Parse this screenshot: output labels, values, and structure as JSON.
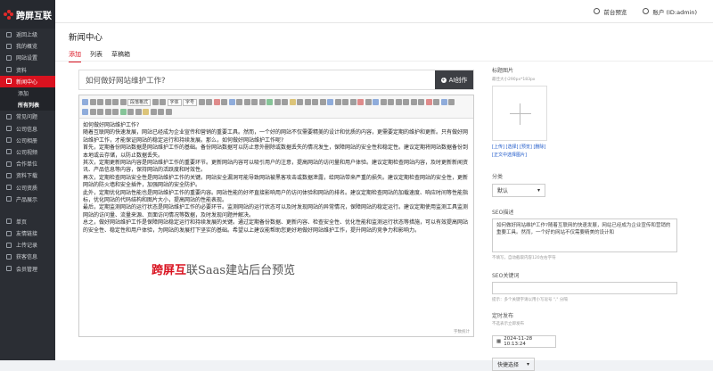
{
  "brand": {
    "name": "跨屏互联"
  },
  "sidebar": {
    "items": [
      {
        "label": "返回上级"
      },
      {
        "label": "我的概览"
      },
      {
        "label": "网站设置"
      },
      {
        "label": "资料"
      },
      {
        "label": "新闻中心",
        "active": true
      },
      {
        "label": "添加",
        "sub": true
      },
      {
        "label": "所有列表",
        "sub": true,
        "on": true
      },
      {
        "label": "常见问题"
      },
      {
        "label": "公司信息"
      },
      {
        "label": "公司相册"
      },
      {
        "label": "公司视频"
      },
      {
        "label": "合作单位"
      },
      {
        "label": "资料下载"
      },
      {
        "label": "公司资质"
      },
      {
        "label": "产品展示"
      },
      {
        "label": "单页"
      },
      {
        "label": "友情链接"
      },
      {
        "label": "上传记录"
      },
      {
        "label": "获客信息"
      },
      {
        "label": "会员管理"
      }
    ]
  },
  "topbar": {
    "preview": "前台预览",
    "account": "账户 (ID:admin)"
  },
  "page": {
    "title": "新闻中心"
  },
  "tabs": [
    "添加",
    "列表",
    "草稿箱"
  ],
  "article": {
    "title_value": "如何做好网站维护工作?",
    "ai_button": "AI创作",
    "paragraphs": [
      "如何做好网站维护工作?",
      "随着互联网的快速发展，网站已经成为企业宣传和营销的重要工具。然而，一个好的网站不仅需要精美的设计和优质的内容，更需要定期的维护和更新。只有做好网站维护工作，才能保证网站的稳定运行和持续发展。那么，如何做好网站维护工作呢?",
      "首先，定期备份网站数据是网站维护工作的基础。备份网站数据可以防止意外删除或数据丢失的情况发生，保障网站的安全性和稳定性。建议定期将网站数据备份到本地或云存储，以防止数据丢失。",
      "其次，定期更新网站内容是网站维护工作的重要环节。更新网站内容可以吸引用户的注意，提高网站的访问量和用户体验。建议定期检查网站内容，及时更新新闻资讯、产品信息等内容，保持网站的活跃度和时效性。",
      "再次，定期检查网站安全性是网站维护工作的关键。网站安全漏洞可能导致网站被黑客攻击或数据泄露，给网站带来严重的损失。建议定期检查网站的安全性，更新网站的防火墙和安全插件，加强网站的安全防护。",
      "此外，定期优化网站性能也是网站维护工作的重要内容。网站性能的好坏直接影响用户的访问体验和网站的排名。建议定期检查网站的加载速度、响应时间等性能指标，优化网站的代码结构和图片大小，提高网站的性能表现。",
      "最后，定期监测网站的运行状态是网站维护工作的必要环节。监测网站的运行状态可以及时发现网站的异常情况，保障网站的稳定运行。建议定期使用监测工具监测网站的访问量、流量来源、页面访问情况等数据，及时发现问题并解决。",
      "总之，做好网站维护工作是保障网站稳定运行和持续发展的关键。通过定期备份数据、更新内容、检查安全性、优化性能和监测运行状态等措施，可以有效提高网站的安全性、稳定性和用户体验，为网站的发展打下坚实的基础。希望以上建议能帮助您更好地做好网站维护工作，提升网站的竞争力和影响力。"
    ],
    "word_count": "字数统计",
    "watermark_red": "跨屏互",
    "watermark_rest": "联Saas建站后台预览"
  },
  "editor_toolbar": {
    "style_select": "段落格式",
    "font_select": "字体",
    "size_select": "字号"
  },
  "panel": {
    "thumb_label": "标题图片",
    "thumb_hint": "最佳大小290px*183px",
    "thumb_links": "[上传] [选择] [预览] [删除]",
    "thumb_links2": "[正文中选择图片]",
    "category_label": "分类",
    "category_value": "默认",
    "seo_desc_label": "SEO描述",
    "seo_desc_value": "如何做好网站维护工作?随着互联网的快速发展，网站已经成为企业宣传和营销的重要工具。然而，一个好的网站不仅需要精美的设计和",
    "seo_desc_hint": "不填写，自动截取内容120左右字符",
    "seo_kw_label": "SEO关键词",
    "seo_kw_hint": "提示：多个关键字请以用小写逗号 \",\" 分隔",
    "publish_label": "定时发布",
    "publish_hint": "不选表示立即发布",
    "publish_value": "2024-11-28 10:13:24",
    "quick_select": "快捷选择"
  }
}
